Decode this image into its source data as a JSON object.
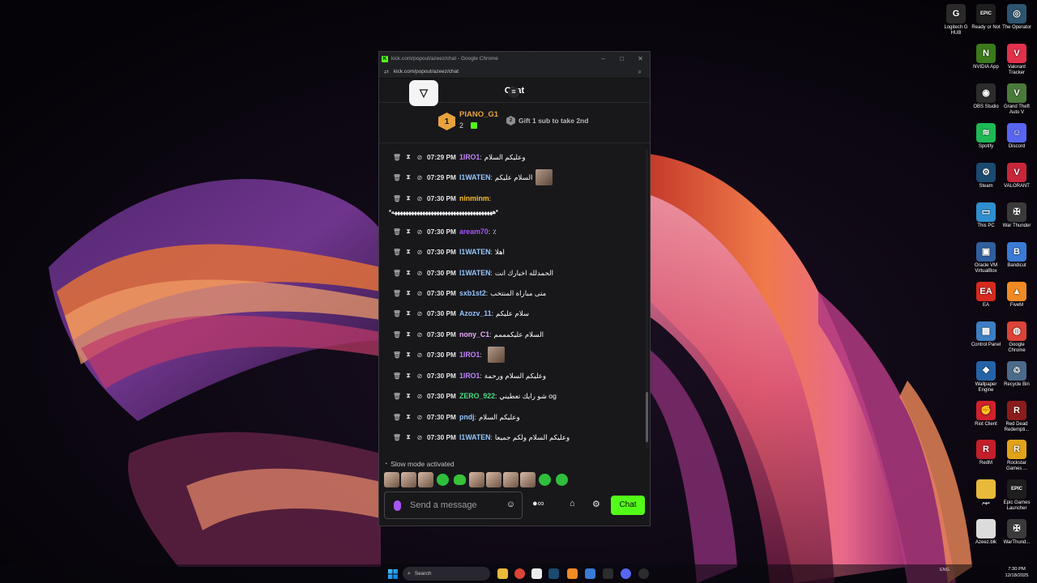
{
  "window": {
    "title": "kick.com/popout/azeez/chat - Google Chrome",
    "url": "kick.com/popout/azeez/chat",
    "chat_title": "Chat"
  },
  "leaderboard": {
    "rank": "1",
    "username": "PIANO_G1",
    "gift_count": "2",
    "hint_rank": "2",
    "hint": "Gift 1 sub to take 2nd"
  },
  "messages": [
    {
      "time": "07:29 PM",
      "user": "1IRO1",
      "user_color": "#c084fc",
      "text": "وعليكم السلام",
      "emote": false
    },
    {
      "time": "07:29 PM",
      "user": "I1WATEN",
      "user_color": "#93c5fd",
      "text": "السلام عليكم",
      "emote": true
    },
    {
      "time": "07:30 PM",
      "user": "ninminm",
      "user_color": "#fbbf24",
      "text": "",
      "emote": false
    },
    {
      "time": "07:30 PM",
      "user": "aream70",
      "user_color": "#a855f7",
      "text": "٪",
      "emote": false
    },
    {
      "time": "07:30 PM",
      "user": "I1WATEN",
      "user_color": "#93c5fd",
      "text": "اهلا",
      "emote": false
    },
    {
      "time": "07:30 PM",
      "user": "I1WATEN",
      "user_color": "#93c5fd",
      "text": "الحمدلله اخبارك انت",
      "emote": false
    },
    {
      "time": "07:30 PM",
      "user": "sxb1st2",
      "user_color": "#93c5fd",
      "text": "متى مباراة المنتخب",
      "emote": false
    },
    {
      "time": "07:30 PM",
      "user": "Azozv_11",
      "user_color": "#93c5fd",
      "text": "سلام عليكم",
      "emote": false
    },
    {
      "time": "07:30 PM",
      "user": "nony_C1",
      "user_color": "#f0abfc",
      "text": "السلام عليكمممم",
      "emote": false
    },
    {
      "time": "07:30 PM",
      "user": "1IRO1",
      "user_color": "#c084fc",
      "text": "",
      "emote": true
    },
    {
      "time": "07:30 PM",
      "user": "1IRO1",
      "user_color": "#c084fc",
      "text": "وعليكم السلام ورحمة",
      "emote": false
    },
    {
      "time": "07:30 PM",
      "user": "ZERO_922",
      "user_color": "#4ade80",
      "text": "شو رايك تعطيني og",
      "emote": false
    },
    {
      "time": "07:30 PM",
      "user": "pndj",
      "user_color": "#93c5fd",
      "text": "وعليكم السلام",
      "emote": false
    },
    {
      "time": "07:30 PM",
      "user": "I1WATEN",
      "user_color": "#93c5fd",
      "text": "وعليكم السلام ولكم جميعا",
      "emote": false
    }
  ],
  "wrap_line": "*ههههههههههههههههههههههههههههههههههههه*",
  "slow_mode": "Slow mode activated",
  "quick_emotes": [
    "photo",
    "photo",
    "photo",
    "frog",
    "blob",
    "photo",
    "photo",
    "photo",
    "photo",
    "frog",
    "frog"
  ],
  "input": {
    "placeholder": "Send a message",
    "send_label": "Chat"
  },
  "desktop_icons": [
    {
      "label": "Logitech G HUB",
      "icon": "logitech-icon",
      "color": "#2a2a2a",
      "glyph": "G"
    },
    {
      "label": "Ready or Not",
      "icon": "epic-icon",
      "color": "#1e1e1e",
      "glyph": "EPIC"
    },
    {
      "label": "The Operator",
      "icon": "operator-icon",
      "color": "#2d5570",
      "glyph": "◎"
    },
    {
      "label": "NVIDIA App",
      "icon": "nvidia-icon",
      "color": "#3a7a1a",
      "glyph": "N"
    },
    {
      "label": "Valorant Tracker",
      "icon": "valorant-tracker-icon",
      "color": "#e2314b",
      "glyph": "V"
    },
    {
      "label": "OBS Studio",
      "icon": "obs-icon",
      "color": "#2c2c2c",
      "glyph": "◉"
    },
    {
      "label": "Grand Theft Auto V",
      "icon": "gta-icon",
      "color": "#4a7a3a",
      "glyph": "V"
    },
    {
      "label": "Spotify",
      "icon": "spotify-icon",
      "color": "#1db954",
      "glyph": "≋"
    },
    {
      "label": "Discord",
      "icon": "discord-icon",
      "color": "#5865f2",
      "glyph": "☺"
    },
    {
      "label": "Steam",
      "icon": "steam-icon",
      "color": "#1b4a70",
      "glyph": "⚙"
    },
    {
      "label": "VALORANT",
      "icon": "valorant-icon",
      "color": "#c8263a",
      "glyph": "V"
    },
    {
      "label": "This PC",
      "icon": "pc-icon",
      "color": "#2f8fcf",
      "glyph": "▭"
    },
    {
      "label": "War Thunder",
      "icon": "war-thunder-icon",
      "color": "#3a3a3a",
      "glyph": "✠"
    },
    {
      "label": "Oracle VM VirtualBox",
      "icon": "virtualbox-icon",
      "color": "#2f5f9f",
      "glyph": "▣"
    },
    {
      "label": "Bandicut",
      "icon": "bandicut-icon",
      "color": "#3a7bd5",
      "glyph": "B"
    },
    {
      "label": "EA",
      "icon": "ea-icon",
      "color": "#d72a1f",
      "glyph": "EA"
    },
    {
      "label": "FiveM",
      "icon": "fivem-icon",
      "color": "#f08a24",
      "glyph": "▲"
    },
    {
      "label": "Control Panel",
      "icon": "control-panel-icon",
      "color": "#3d7fc4",
      "glyph": "▦"
    },
    {
      "label": "Google Chrome",
      "icon": "chrome-icon",
      "color": "#db4437",
      "glyph": "◍"
    },
    {
      "label": "Wallpaper Engine",
      "icon": "wallpaper-engine-icon",
      "color": "#2563a8",
      "glyph": "❖"
    },
    {
      "label": "Recycle Bin",
      "icon": "recycle-bin-icon",
      "color": "#4b6b8b",
      "glyph": "♲"
    },
    {
      "label": "Riot Client",
      "icon": "riot-icon",
      "color": "#d0212c",
      "glyph": "✊"
    },
    {
      "label": "Red Dead Redempti...",
      "icon": "red-dead-icon",
      "color": "#8b1c1c",
      "glyph": "R"
    },
    {
      "label": "RedM",
      "icon": "redm-icon",
      "color": "#c41e2a",
      "glyph": "R"
    },
    {
      "label": "Rockstar Games ...",
      "icon": "rockstar-icon",
      "color": "#e0a31a",
      "glyph": "R"
    },
    {
      "label": "مهم",
      "icon": "folder-icon",
      "color": "#e8b93a",
      "glyph": ""
    },
    {
      "label": "Epic Games Launcher",
      "icon": "epic-launcher-icon",
      "color": "#1e1e1e",
      "glyph": "EPIC"
    },
    {
      "label": "Azeez.blk",
      "icon": "file-icon",
      "color": "#dcdcdc",
      "glyph": ""
    },
    {
      "label": "WarThund...",
      "icon": "war-thunder-2-icon",
      "color": "#3a3a3a",
      "glyph": "✠"
    }
  ],
  "taskbar": {
    "search": "Search",
    "lang": "ENG",
    "time": "7:30 PM",
    "date": "12/18/2025"
  }
}
